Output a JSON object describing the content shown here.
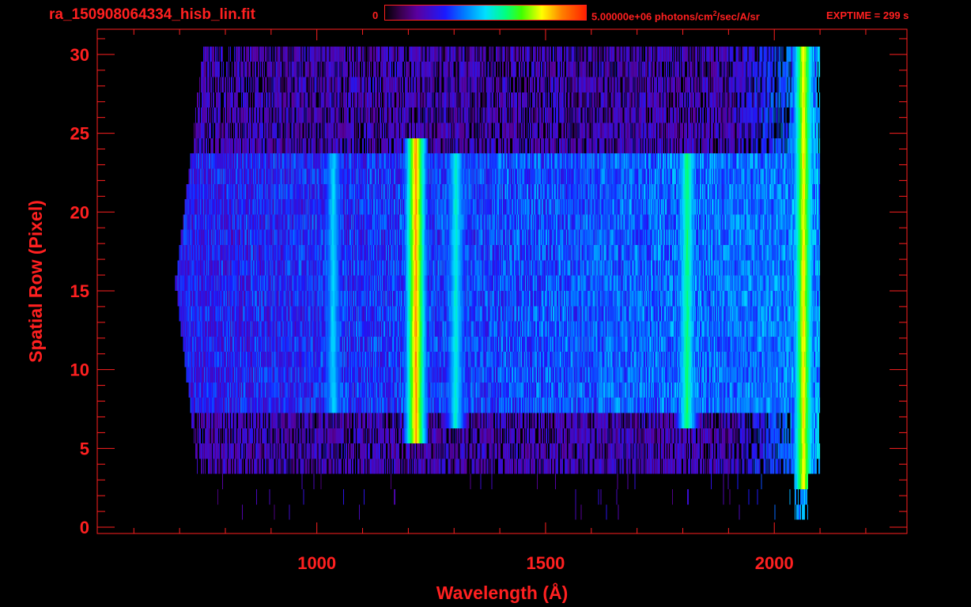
{
  "header": {
    "filename": "ra_150908064334_hisb_lin.fit",
    "colorbar_min": "0",
    "colorbar_max_prefix": "5.00000e+06 photons/cm",
    "colorbar_max_sup": "2",
    "colorbar_max_suffix": "/sec/A/sr",
    "exptime": "EXPTIME = 299 s"
  },
  "chart_data": {
    "type": "heatmap",
    "xlabel": "Wavelength (Å)",
    "ylabel": "Spatial Row (Pixel)",
    "xlim": [
      520,
      2290
    ],
    "ylim": [
      -0.4,
      31.6
    ],
    "x_ticks": [
      1000,
      1500,
      2000
    ],
    "x_tick_labels": [
      "1000",
      "1500",
      "2000"
    ],
    "y_ticks": [
      0,
      5,
      10,
      15,
      20,
      25,
      30
    ],
    "y_tick_labels": [
      "0",
      "5",
      "10",
      "15",
      "20",
      "25",
      "30"
    ],
    "color_scale": {
      "min": 0,
      "max": 5000000,
      "units": "photons/cm^2/sec/A/sr"
    },
    "data_extent": {
      "x": [
        690,
        2100
      ],
      "rows": [
        0,
        30
      ]
    },
    "bright_features": [
      {
        "center_wavelength": 1216,
        "level": 0.88,
        "rows": [
          5,
          24
        ]
      },
      {
        "center_wavelength": 1304,
        "level": 0.55,
        "rows": [
          6,
          23
        ]
      },
      {
        "center_wavelength": 1035,
        "level": 0.5,
        "rows": [
          7,
          23
        ]
      },
      {
        "center_wavelength": 1810,
        "level": 0.62,
        "rows": [
          6,
          23
        ]
      },
      {
        "center_wavelength": 2065,
        "level": 0.8,
        "rows": [
          2,
          30
        ]
      }
    ],
    "colors": {
      "axis": "#ff2020",
      "background": "#000000"
    }
  }
}
